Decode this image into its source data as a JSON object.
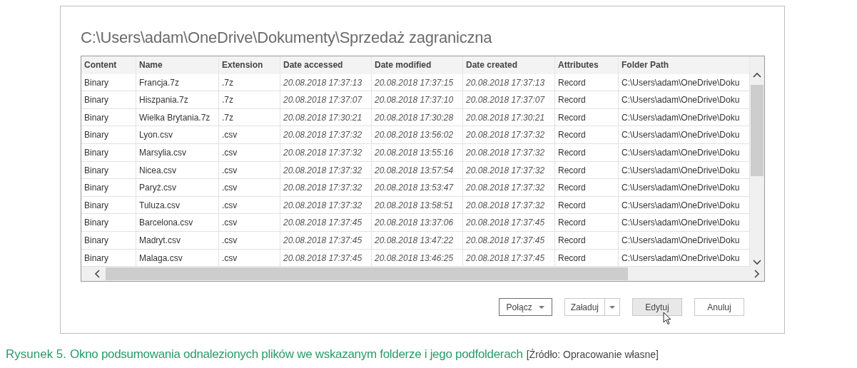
{
  "dialog": {
    "title": "C:\\Users\\adam\\OneDrive\\Dokumenty\\Sprzedaż zagraniczna"
  },
  "table": {
    "columns": [
      {
        "label": "Content",
        "kind": "text"
      },
      {
        "label": "Name",
        "kind": "text"
      },
      {
        "label": "Extension",
        "kind": "text"
      },
      {
        "label": "Date accessed",
        "kind": "date"
      },
      {
        "label": "Date modified",
        "kind": "date"
      },
      {
        "label": "Date created",
        "kind": "date"
      },
      {
        "label": "Attributes",
        "kind": "text"
      },
      {
        "label": "Folder Path",
        "kind": "text"
      }
    ],
    "rows": [
      [
        "Binary",
        "Francja.7z",
        ".7z",
        "20.08.2018 17:37:13",
        "20.08.2018 17:37:15",
        "20.08.2018 17:37:13",
        "Record",
        "C:\\Users\\adam\\OneDrive\\Doku"
      ],
      [
        "Binary",
        "Hiszpania.7z",
        ".7z",
        "20.08.2018 17:37:07",
        "20.08.2018 17:37:10",
        "20.08.2018 17:37:07",
        "Record",
        "C:\\Users\\adam\\OneDrive\\Doku"
      ],
      [
        "Binary",
        "Wielka Brytania.7z",
        ".7z",
        "20.08.2018 17:30:21",
        "20.08.2018 17:30:28",
        "20.08.2018 17:30:21",
        "Record",
        "C:\\Users\\adam\\OneDrive\\Doku"
      ],
      [
        "Binary",
        "Lyon.csv",
        ".csv",
        "20.08.2018 17:37:32",
        "20.08.2018 13:56:02",
        "20.08.2018 17:37:32",
        "Record",
        "C:\\Users\\adam\\OneDrive\\Doku"
      ],
      [
        "Binary",
        "Marsylia.csv",
        ".csv",
        "20.08.2018 17:37:32",
        "20.08.2018 13:55:16",
        "20.08.2018 17:37:32",
        "Record",
        "C:\\Users\\adam\\OneDrive\\Doku"
      ],
      [
        "Binary",
        "Nicea.csv",
        ".csv",
        "20.08.2018 17:37:32",
        "20.08.2018 13:57:54",
        "20.08.2018 17:37:32",
        "Record",
        "C:\\Users\\adam\\OneDrive\\Doku"
      ],
      [
        "Binary",
        "Paryż.csv",
        ".csv",
        "20.08.2018 17:37:32",
        "20.08.2018 13:53:47",
        "20.08.2018 17:37:32",
        "Record",
        "C:\\Users\\adam\\OneDrive\\Doku"
      ],
      [
        "Binary",
        "Tuluza.csv",
        ".csv",
        "20.08.2018 17:37:32",
        "20.08.2018 13:58:51",
        "20.08.2018 17:37:32",
        "Record",
        "C:\\Users\\adam\\OneDrive\\Doku"
      ],
      [
        "Binary",
        "Barcelona.csv",
        ".csv",
        "20.08.2018 17:37:45",
        "20.08.2018 13:37:06",
        "20.08.2018 17:37:45",
        "Record",
        "C:\\Users\\adam\\OneDrive\\Doku"
      ],
      [
        "Binary",
        "Madryt.csv",
        ".csv",
        "20.08.2018 17:37:45",
        "20.08.2018 13:47:22",
        "20.08.2018 17:37:45",
        "Record",
        "C:\\Users\\adam\\OneDrive\\Doku"
      ],
      [
        "Binary",
        "Malaga.csv",
        ".csv",
        "20.08.2018 17:37:45",
        "20.08.2018 13:46:25",
        "20.08.2018 17:37:45",
        "Record",
        "C:\\Users\\adam\\OneDrive\\Doku"
      ]
    ]
  },
  "buttons": [
    {
      "label": "Połącz",
      "kind": "dropdown",
      "focused": true,
      "hovered": false
    },
    {
      "label": "Załaduj",
      "kind": "split",
      "focused": false,
      "hovered": false
    },
    {
      "label": "Edytuj",
      "kind": "plain",
      "focused": false,
      "hovered": true
    },
    {
      "label": "Anuluj",
      "kind": "plain",
      "focused": false,
      "hovered": false
    }
  ],
  "caption": {
    "label": "Rysunek 5.",
    "text": "Okno podsumowania odnalezionych plików we wskazanym folderze i jego podfolderach",
    "source": "[Źródło: Opracowanie własne]"
  }
}
